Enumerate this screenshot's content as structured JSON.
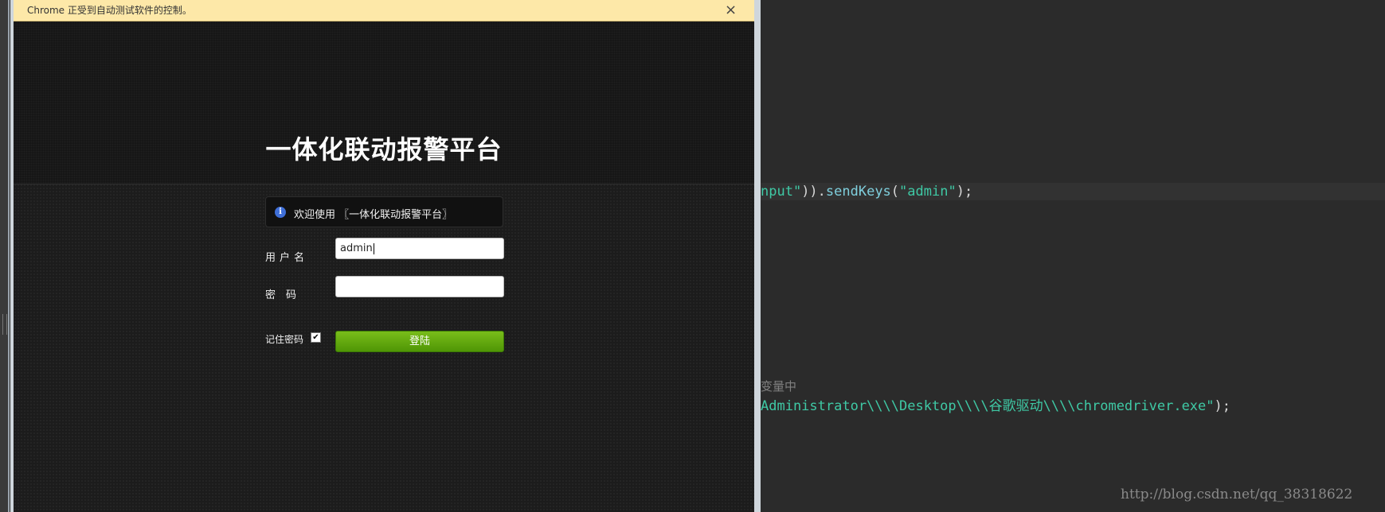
{
  "browser": {
    "infobar_message": "Chrome 正受到自动测试软件的控制。",
    "close_symbol": "×"
  },
  "login_page": {
    "title": "一体化联动报警平台",
    "notice_icon": "i",
    "notice_text": "欢迎使用 〖一体化联动报警平台〗",
    "username_label": "用户名",
    "username_value": "admin",
    "password_label": "密　码",
    "password_value": "",
    "remember_label": "记住密码",
    "remember_checked": "✔",
    "login_button": "登陆"
  },
  "editor": {
    "line1_str_end": "nput\"",
    "line1_rest_a": ")).",
    "line1_method": "sendKeys",
    "line1_paren_open": "(",
    "line1_arg": "\"admin\"",
    "line1_paren_close": ");",
    "comment": "变量中",
    "line2_path": "Administrator\\\\\\\\Desktop\\\\\\\\谷歌驱动\\\\\\\\chromedriver.exe\"",
    "line2_end": ");"
  },
  "watermark": "http://blog.csdn.net/qq_38318622"
}
